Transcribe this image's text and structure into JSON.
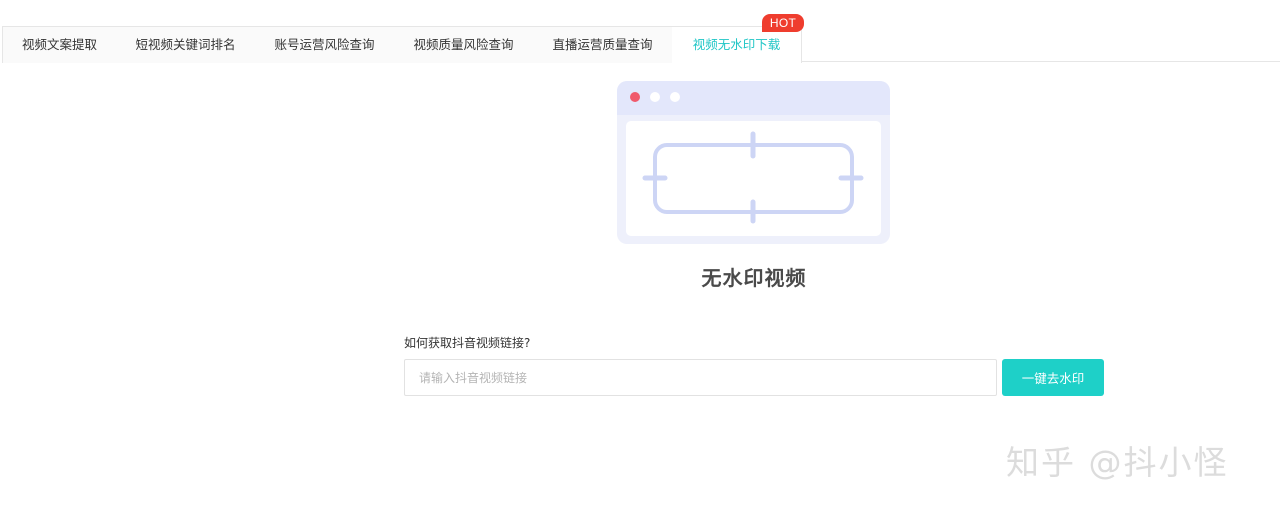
{
  "tabs": [
    {
      "label": "视频文案提取"
    },
    {
      "label": "短视频关键词排名"
    },
    {
      "label": "账号运营风险查询"
    },
    {
      "label": "视频质量风险查询"
    },
    {
      "label": "直播运营质量查询"
    },
    {
      "label": "视频无水印下载",
      "active": true,
      "badge": "HOT"
    }
  ],
  "main": {
    "title": "无水印视频",
    "help_link": "如何获取抖音视频链接?",
    "input": {
      "value": "",
      "placeholder": "请输入抖音视频链接"
    },
    "submit_label": "一键去水印"
  },
  "watermark": "知乎 @抖小怪",
  "colors": {
    "accent": "#1ed0c8",
    "active_tab_text": "#20c6c6",
    "hot_badge": "#ef3d2e",
    "illustration_frame": "#eef0fb",
    "illustration_stroke": "#cdd5f5",
    "window_dot_red": "#f05a6c"
  },
  "icons": {
    "illustration": "browser-window-crop-icon"
  }
}
